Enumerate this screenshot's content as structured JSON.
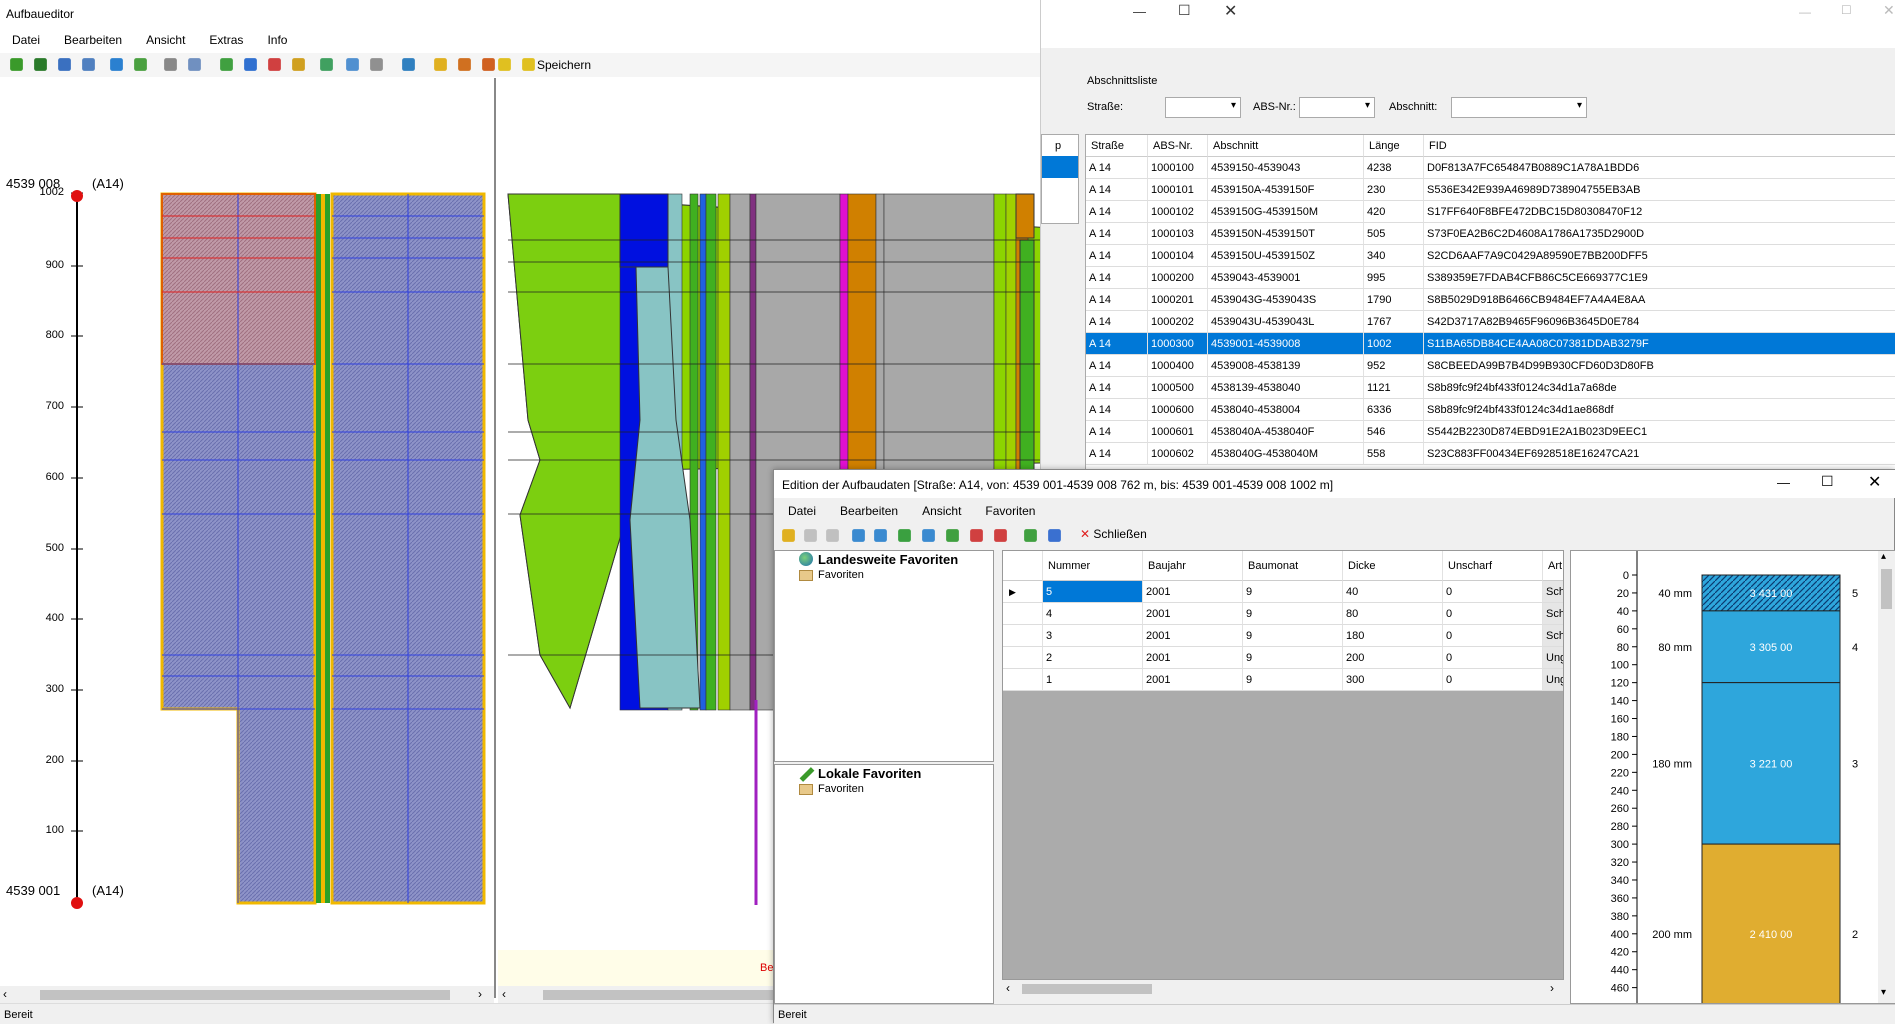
{
  "main": {
    "title": "Aufbaueditor",
    "menu": [
      "Datei",
      "Bearbeiten",
      "Ansicht",
      "Extras",
      "Info"
    ],
    "save_label": "Speichern",
    "status": "Bereit",
    "station_top": "4539 008",
    "station_bottom": "4539 001",
    "road_top": "(A14)",
    "road_bottom": "(A14)",
    "axis_ticks": [
      "1002",
      "900",
      "800",
      "700",
      "600",
      "500",
      "400",
      "300",
      "200",
      "100"
    ],
    "red_fragment": "Be"
  },
  "list": {
    "group_title": "Abschnittsliste",
    "strasse_label": "Straße:",
    "absnr_label": "ABS-Nr.:",
    "abschnitt_label": "Abschnitt:",
    "left_col_fragment": "p",
    "columns": [
      "Straße",
      "ABS-Nr.",
      "Abschnitt",
      "Länge",
      "FID"
    ],
    "rows": [
      [
        "A 14",
        "1000100",
        "4539150-4539043",
        "4238",
        "D0F813A7FC654847B0889C1A78A1BDD6"
      ],
      [
        "A 14",
        "1000101",
        "4539150A-4539150F",
        "230",
        "S536E342E939A46989D738904755EB3AB"
      ],
      [
        "A 14",
        "1000102",
        "4539150G-4539150M",
        "420",
        "S17FF640F8BFE472DBC15D80308470F12"
      ],
      [
        "A 14",
        "1000103",
        "4539150N-4539150T",
        "505",
        "S73F0EA2B6C2D4608A1786A1735D2900D"
      ],
      [
        "A 14",
        "1000104",
        "4539150U-4539150Z",
        "340",
        "S2CD6AAF7A9C0429A89590E7BB200DFF5"
      ],
      [
        "A 14",
        "1000200",
        "4539043-4539001",
        "995",
        "S389359E7FDAB4CFB86C5CE669377C1E9"
      ],
      [
        "A 14",
        "1000201",
        "4539043G-4539043S",
        "1790",
        "S8B5029D918B6466CB9484EF7A4A4E8AA"
      ],
      [
        "A 14",
        "1000202",
        "4539043U-4539043L",
        "1767",
        "S42D3717A82B9465F96096B3645D0E784"
      ],
      [
        "A 14",
        "1000300",
        "4539001-4539008",
        "1002",
        "S11BA65DB84CE4AA08C07381DDAB3279F"
      ],
      [
        "A 14",
        "1000400",
        "4539008-4538139",
        "952",
        "S8CBEEDA99B7B4D99B930CFD60D3D80FB"
      ],
      [
        "A 14",
        "1000500",
        "4538139-4538040",
        "1121",
        "S8b89fc9f24bf433f0124c34d1a7a68de"
      ],
      [
        "A 14",
        "1000600",
        "4538040-4538004",
        "6336",
        "S8b89fc9f24bf433f0124c34d1ae868df"
      ],
      [
        "A 14",
        "1000601",
        "4538040A-4538040F",
        "546",
        "S5442B2230D874EBD91E2A1B023D9EEC1"
      ],
      [
        "A 14",
        "1000602",
        "4538040G-4538040M",
        "558",
        "S23C883FF00434EF6928518E16247CA21"
      ]
    ],
    "selected_index": 8
  },
  "edition": {
    "title": "Edition der Aufbaudaten [Straße: A14, von: 4539 001-4539 008 762 m, bis: 4539 001-4539 008 1002 m]",
    "menu": [
      "Datei",
      "Bearbeiten",
      "Ansicht",
      "Favoriten"
    ],
    "close_label": "Schließen",
    "status": "Bereit",
    "fav_global": "Landesweite Favoriten",
    "fav_global_child": "Favoriten",
    "fav_local": "Lokale Favoriten",
    "fav_local_child": "Favoriten",
    "columns": [
      "Nummer",
      "Baujahr",
      "Baumonat",
      "Dicke",
      "Unscharf",
      "Art"
    ],
    "rows": [
      [
        "5",
        "2001",
        "9",
        "40",
        "0",
        "Sch"
      ],
      [
        "4",
        "2001",
        "9",
        "80",
        "0",
        "Sch"
      ],
      [
        "3",
        "2001",
        "9",
        "180",
        "0",
        "Sch"
      ],
      [
        "2",
        "2001",
        "9",
        "200",
        "0",
        "Ung"
      ],
      [
        "1",
        "2001",
        "9",
        "300",
        "0",
        "Ung"
      ]
    ],
    "layers": [
      {
        "thickness": "40 mm",
        "code": "3 431 00",
        "number": "5",
        "mm": 40,
        "color": "#2ea6dc",
        "hatch": true
      },
      {
        "thickness": "80 mm",
        "code": "3 305 00",
        "number": "4",
        "mm": 80,
        "color": "#2ea6dc",
        "hatch": false
      },
      {
        "thickness": "180 mm",
        "code": "3 221 00",
        "number": "3",
        "mm": 180,
        "color": "#2ea6dc",
        "hatch": false
      },
      {
        "thickness": "200 mm",
        "code": "2 410 00",
        "number": "2",
        "mm": 200,
        "color": "#e0ad30",
        "hatch": false
      }
    ],
    "depth_ticks": [
      "0",
      "20",
      "40",
      "60",
      "80",
      "100",
      "120",
      "140",
      "160",
      "180",
      "200",
      "220",
      "240",
      "260",
      "280",
      "300",
      "320",
      "340",
      "360",
      "380",
      "400",
      "420",
      "440",
      "460"
    ]
  }
}
